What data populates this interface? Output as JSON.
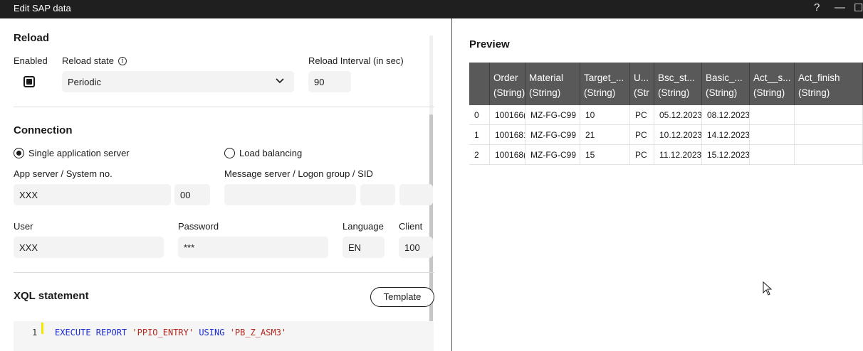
{
  "window": {
    "title": "Edit SAP data",
    "help_glyph": "?",
    "minimize_glyph": "—",
    "maximize_glyph": "☐"
  },
  "reload": {
    "section_title": "Reload",
    "enabled_label": "Enabled",
    "enabled_checked": true,
    "state_label": "Reload state",
    "state_value": "Periodic",
    "interval_label": "Reload Interval (in sec)",
    "interval_value": "90"
  },
  "connection": {
    "section_title": "Connection",
    "option_single": "Single application server",
    "option_single_selected": true,
    "option_balancing": "Load balancing",
    "app_server_label": "App server / System no.",
    "app_server_value": "XXX",
    "system_no_value": "00",
    "message_server_label": "Message server / Logon group / SID",
    "message_server_value": "",
    "logon_group_value": "",
    "sid_value": "",
    "user_label": "User",
    "user_value": "XXX",
    "password_label": "Password",
    "password_value": "***",
    "language_label": "Language",
    "language_value": "EN",
    "client_label": "Client",
    "client_value": "100"
  },
  "xql": {
    "section_title": "XQL statement",
    "template_button": "Template",
    "line_number": "1",
    "code_keyword1": "EXECUTE REPORT",
    "code_string1": "'PPIO_ENTRY'",
    "code_keyword2": "USING",
    "code_string2": "'PB_Z_ASM3'"
  },
  "preview": {
    "title": "Preview",
    "columns": [
      {
        "name": "Order",
        "type": "(String)"
      },
      {
        "name": "Material",
        "type": "(String)"
      },
      {
        "name": "Target_...",
        "type": "(String)"
      },
      {
        "name": "U...",
        "type": "(Str"
      },
      {
        "name": "Bsc_st...",
        "type": "(String)"
      },
      {
        "name": "Basic_...",
        "type": "(String)"
      },
      {
        "name": "Act__s...",
        "type": "(String)"
      },
      {
        "name": "Act_finish",
        "type": "(String)"
      }
    ],
    "rows": [
      {
        "idx": "0",
        "cells": [
          "100166(",
          "MZ-FG-C99",
          "10",
          "PC",
          "05.12.2023",
          "08.12.2023",
          "",
          ""
        ]
      },
      {
        "idx": "1",
        "cells": [
          "1001681",
          "MZ-FG-C99",
          "21",
          "PC",
          "10.12.2023",
          "14.12.2023",
          "",
          ""
        ]
      },
      {
        "idx": "2",
        "cells": [
          "100168(",
          "MZ-FG-C99",
          "15",
          "PC",
          "11.12.2023",
          "15.12.2023",
          "",
          ""
        ]
      }
    ]
  },
  "colors": {
    "titlebar": "#1f1f1f",
    "grid_header": "#595959",
    "keyword": "#1a2bd6",
    "string": "#b3261e",
    "line_marker": "#f2e600"
  }
}
